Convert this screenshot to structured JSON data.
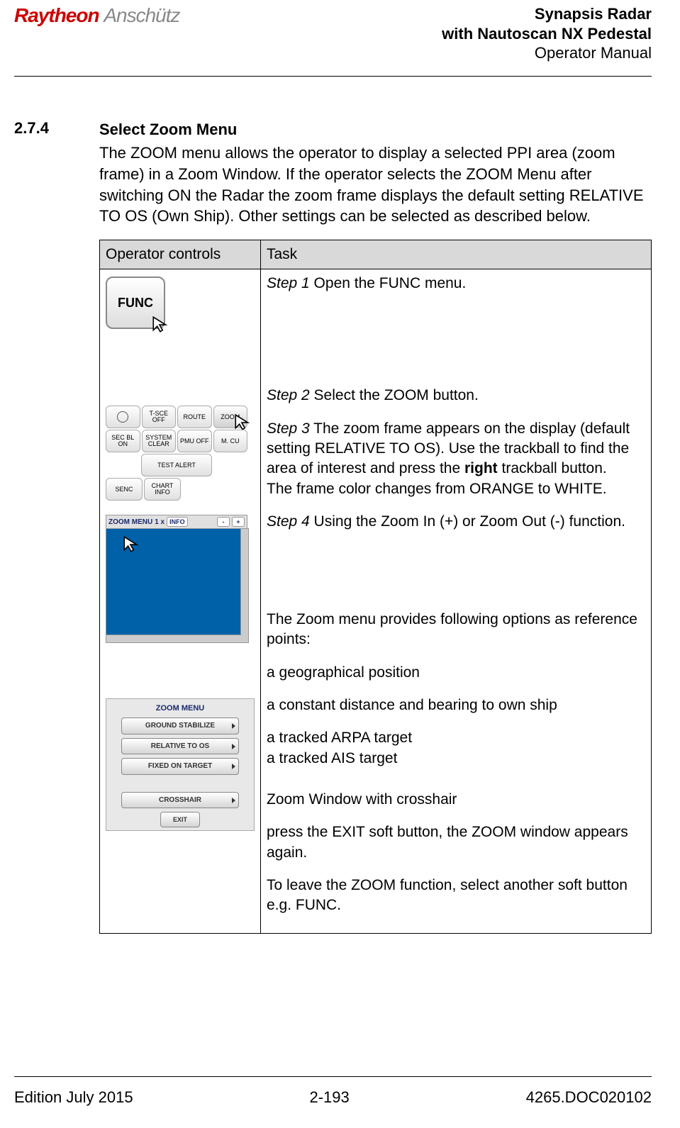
{
  "header": {
    "logo_brand": "Raytheon",
    "logo_sub": "Anschütz",
    "title_line1": "Synapsis Radar",
    "title_line2": "with Nautoscan NX Pedestal",
    "title_line3": "Operator Manual"
  },
  "section": {
    "number": "2.7.4",
    "title": "Select Zoom Menu",
    "intro": "The ZOOM menu allows the operator to display a selected PPI area (zoom frame) in a Zoom Window. If the operator selects the ZOOM Menu after switching ON the Radar the zoom frame displays the default setting RELATIVE TO OS (Own Ship). Other settings can be selected as described below."
  },
  "table": {
    "head_op": "Operator controls",
    "head_task": "Task"
  },
  "op": {
    "func_label": "FUNC",
    "toolbar": {
      "row1": [
        "",
        "T-SCE OFF",
        "ROUTE",
        "ZOOM"
      ],
      "row2": [
        "SEC BL ON",
        "SYSTEM CLEAR",
        "PMU OFF",
        "M. CU"
      ],
      "row3": [
        "",
        "TEST ALERT",
        "",
        ""
      ],
      "row4": [
        "SENC",
        "CHART INFO",
        "",
        ""
      ]
    },
    "zoom_bar": {
      "menu": "ZOOM MENU",
      "scale": "1 x",
      "info": "INFO",
      "minus": "-",
      "plus": "+"
    },
    "zoom_menu": {
      "title": "ZOOM MENU",
      "btn1": "GROUND STABILIZE",
      "btn2": "RELATIVE TO OS",
      "btn3": "FIXED ON TARGET",
      "btn4": "CROSSHAIR",
      "exit": "EXIT"
    }
  },
  "task": {
    "s1_label": "Step 1",
    "s1_text": " Open the FUNC menu.",
    "s2_label": "Step 2",
    "s2_text": " Select the ZOOM button.",
    "s3_label": "Step 3",
    "s3_text_a": " The zoom frame appears on the display (default setting RELATIVE TO OS). Use the trackball to find the area of interest and press the ",
    "s3_bold": "right",
    "s3_text_b": " trackball button.",
    "s3_line2": "The frame color changes from ORANGE to WHITE.",
    "s4_label": "Step 4",
    "s4_text": " Using the Zoom In (+) or Zoom Out (-) function.",
    "ref_intro": "The Zoom menu provides following options as reference points:",
    "ref1": "a geographical position",
    "ref2": "a constant distance and bearing to own ship",
    "ref3": "a tracked ARPA target",
    "ref4": "a tracked AIS target",
    "ref5": "Zoom Window with crosshair",
    "exit_text": "press the EXIT soft button, the ZOOM window appears again.",
    "leave_text": "To leave the ZOOM function, select another soft button e.g. FUNC."
  },
  "footer": {
    "left": "Edition July 2015",
    "center": "2-193",
    "right": "4265.DOC020102"
  }
}
